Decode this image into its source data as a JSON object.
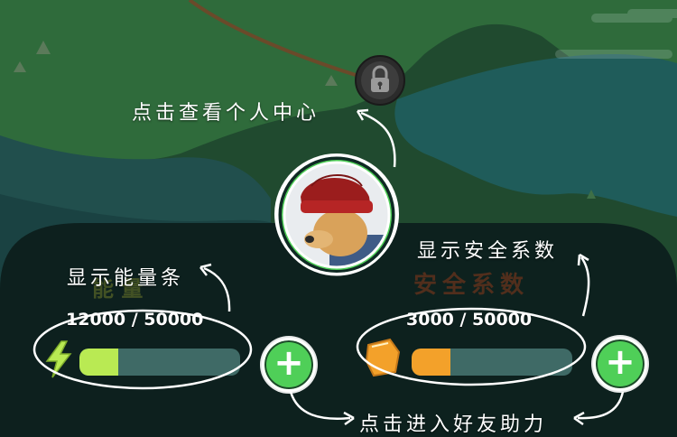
{
  "annotations": {
    "profile": "点击查看个人中心",
    "energy": "显示能量条",
    "safety": "显示安全系数",
    "help": "点击进入好友助力"
  },
  "energy_panel": {
    "faint_label": "能  量",
    "value_text": "12000 / 50000",
    "current": 12000,
    "max": 50000,
    "fill_fraction": 0.24,
    "fill_color": "#b9ea53"
  },
  "safety_panel": {
    "faint_label": "安全系数",
    "value_text": "3000 / 50000",
    "current": 3000,
    "max": 50000,
    "fill_fraction": 0.24,
    "fill_color": "#f3a12a"
  },
  "icons": {
    "lock": "lock-icon",
    "avatar": "dog-avatar",
    "lightning": "lightning-icon",
    "shield": "shield-icon",
    "plus": "plus-icon"
  },
  "colors": {
    "map_green": "#2f6b3b",
    "water": "#1d5a5a",
    "panel": "#0d1f1d",
    "plus_green": "#4fcf58"
  }
}
